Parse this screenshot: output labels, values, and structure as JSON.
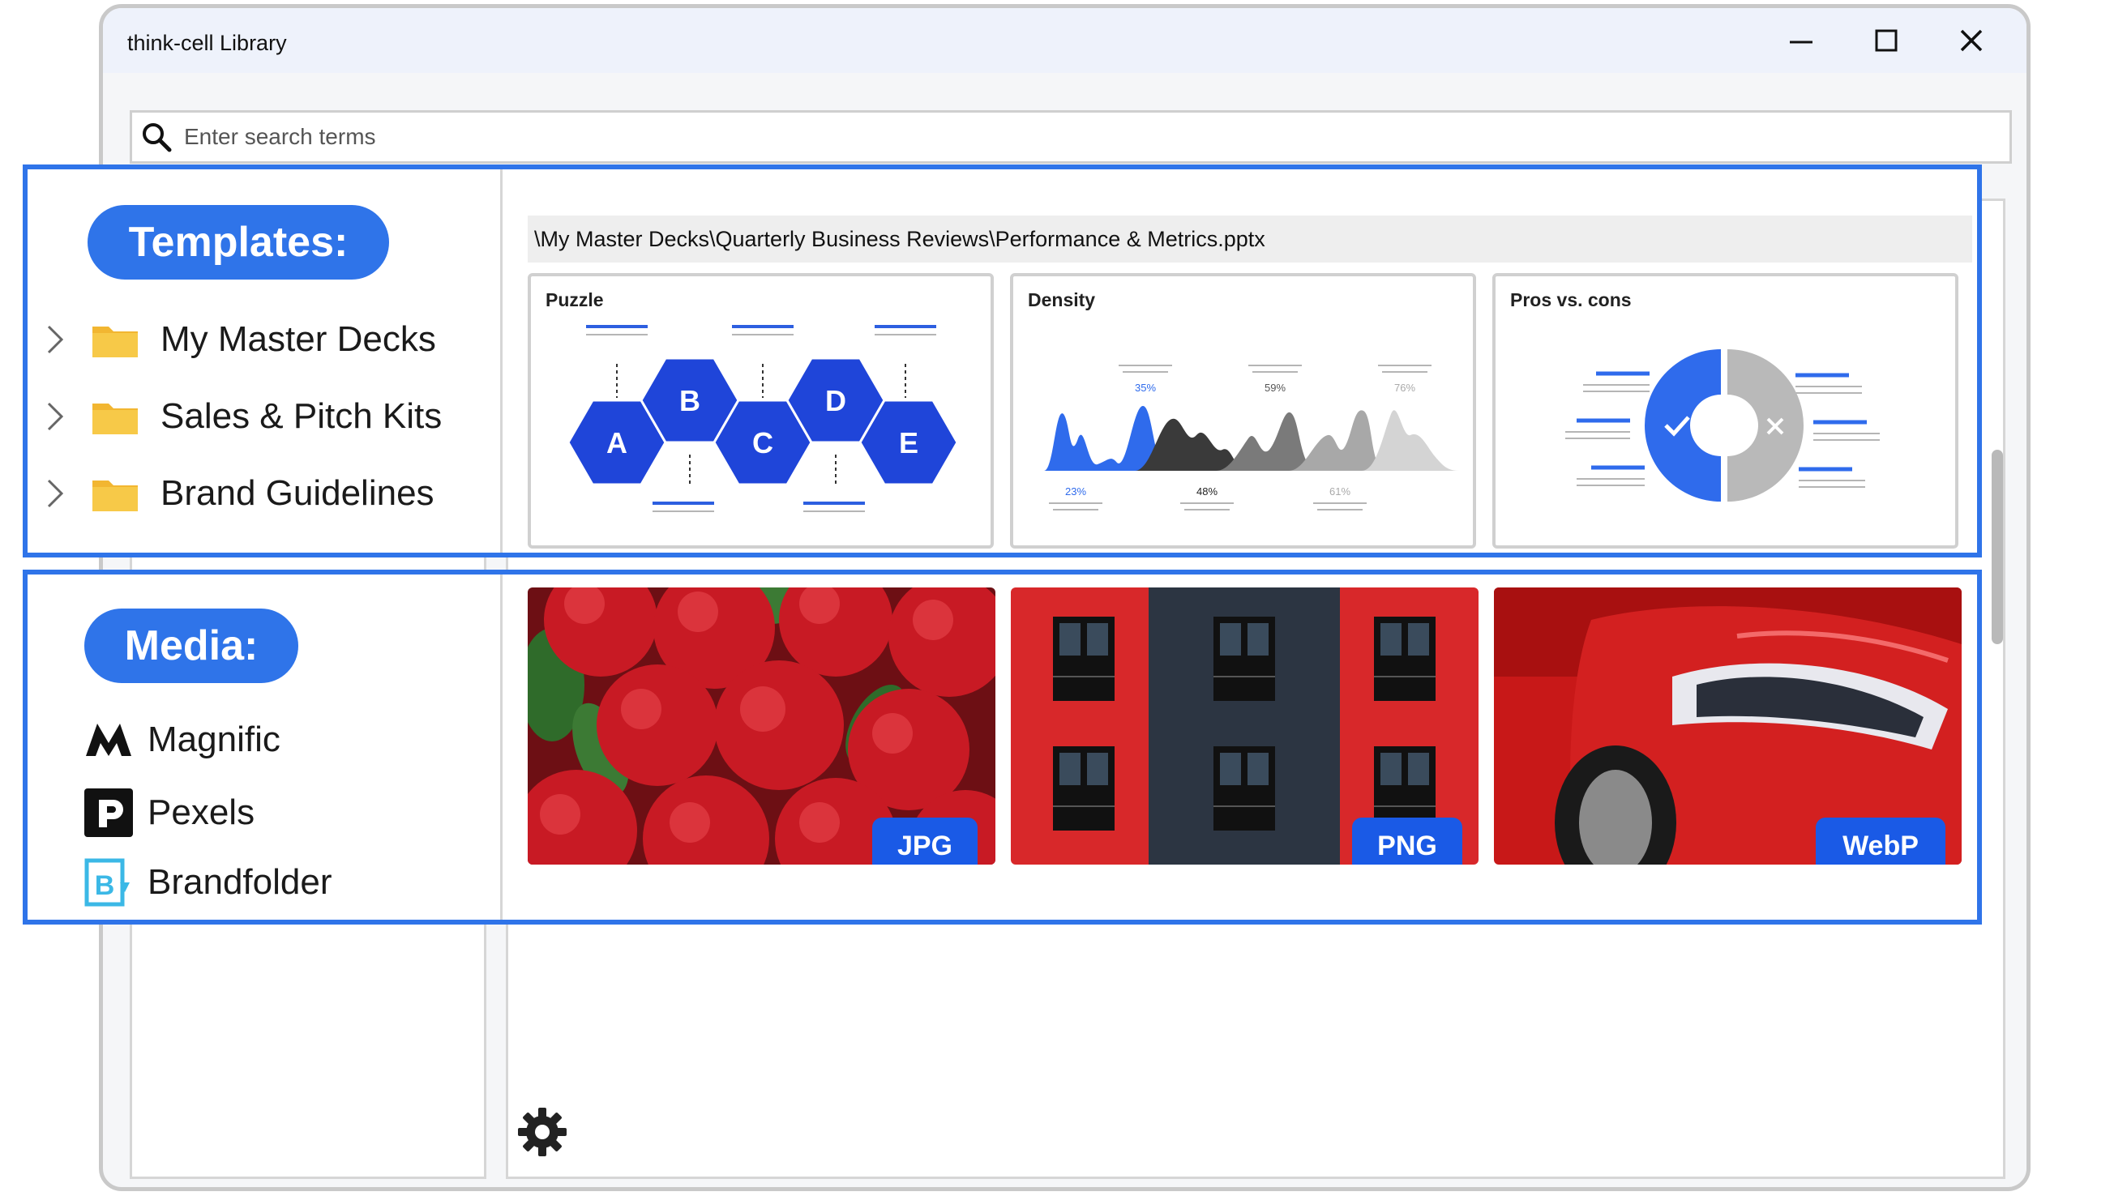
{
  "window": {
    "title": "think-cell Library"
  },
  "search": {
    "placeholder": "Enter search terms"
  },
  "templates": {
    "heading": "Templates:",
    "folders": [
      {
        "label": "My Master Decks"
      },
      {
        "label": "Sales & Pitch Kits"
      },
      {
        "label": "Brand Guidelines"
      }
    ],
    "path": "\\My Master Decks\\Quarterly Business Reviews\\Performance & Metrics.pptx",
    "cards": [
      {
        "title": "Puzzle",
        "letters": [
          "A",
          "B",
          "C",
          "D",
          "E"
        ]
      },
      {
        "title": "Density",
        "labels_top": [
          "35%",
          "59%",
          "76%"
        ],
        "labels_bottom": [
          "23%",
          "48%",
          "61%"
        ]
      },
      {
        "title": "Pros vs. cons"
      }
    ]
  },
  "media": {
    "heading": "Media:",
    "sources": [
      {
        "label": "Magnific",
        "icon": "magnific-logo-icon"
      },
      {
        "label": "Pexels",
        "icon": "pexels-logo-icon"
      },
      {
        "label": "Brandfolder",
        "icon": "brandfolder-logo-icon"
      }
    ],
    "tiles": [
      {
        "format": "JPG",
        "subject": "apples"
      },
      {
        "format": "PNG",
        "subject": "building"
      },
      {
        "format": "WebP",
        "subject": "car"
      }
    ]
  },
  "colors": {
    "accent": "#2f74e9",
    "badge": "#1a5ae6",
    "folder": "#f7c948"
  }
}
